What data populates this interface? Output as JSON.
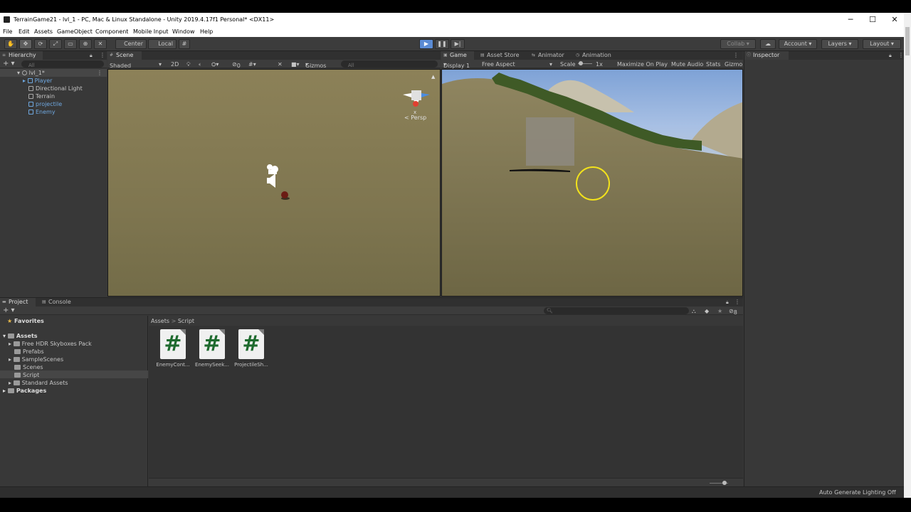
{
  "window": {
    "title": "TerrainGame21 - lvl_1 - PC, Mac & Linux Standalone - Unity 2019.4.17f1 Personal* <DX11>",
    "minimize": "─",
    "maximize": "☐",
    "close": "✕"
  },
  "menu": [
    "File",
    "Edit",
    "Assets",
    "GameObject",
    "Component",
    "Mobile Input",
    "Window",
    "Help"
  ],
  "toolbar": {
    "pivot_label": "Center",
    "space_label": "Local",
    "collab_label": "Collab",
    "account_label": "Account",
    "layers_label": "Layers",
    "layout_label": "Layout"
  },
  "hierarchy": {
    "tab": "Hierarchy",
    "search_placeholder": "All",
    "scene_name": "lvl_1*",
    "objects": [
      "Player",
      "Directional Light",
      "Terrain",
      "projectile",
      "Enemy"
    ]
  },
  "scene": {
    "tab": "Scene",
    "shading": "Shaded",
    "mode_2d": "2D",
    "hidden_count": "0",
    "gizmos": "Gizmos",
    "search_placeholder": "All",
    "projection": "< Persp",
    "axis_x": "x"
  },
  "game": {
    "tabs": [
      "Game",
      "Asset Store",
      "Animator",
      "Animation"
    ],
    "display": "Display 1",
    "aspect": "Free Aspect",
    "scale_label": "Scale",
    "scale_value": "1x",
    "maximize_on_play": "Maximize On Play",
    "mute_audio": "Mute Audio",
    "stats": "Stats",
    "gizmos": "Gizmo"
  },
  "inspector": {
    "tab": "Inspector"
  },
  "project": {
    "tabs": [
      "Project",
      "Console"
    ],
    "breadcrumb": [
      "Assets",
      "Script"
    ],
    "favorites": "Favorites",
    "tree": [
      {
        "label": "Assets",
        "level": 0
      },
      {
        "label": "Free HDR Skyboxes Pack",
        "level": 1
      },
      {
        "label": "Prefabs",
        "level": 1
      },
      {
        "label": "SampleScenes",
        "level": 1
      },
      {
        "label": "Scenes",
        "level": 1
      },
      {
        "label": "Script",
        "level": 1
      },
      {
        "label": "Standard Assets",
        "level": 1
      },
      {
        "label": "Packages",
        "level": 0
      }
    ],
    "assets": [
      "EnemyCont...",
      "EnemySeek...",
      "ProjectileSh..."
    ],
    "asset_glyph": "#",
    "hidden_count": "8"
  },
  "status": {
    "text": "Auto Generate Lighting Off"
  },
  "colors": {
    "play_active": "#5b8bd3",
    "selection": "#2c5d87",
    "cursor_ring": "#f2e21c"
  }
}
